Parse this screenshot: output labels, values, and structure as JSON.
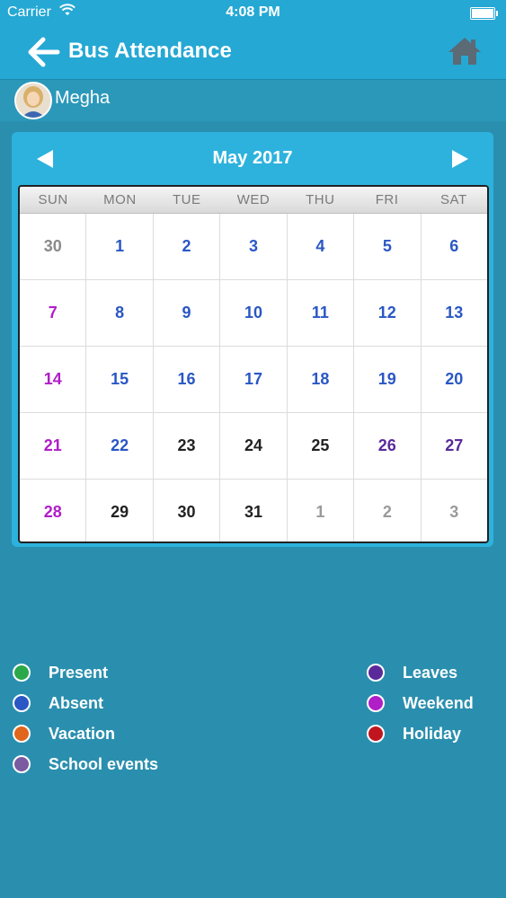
{
  "status": {
    "carrier": "Carrier",
    "time": "4:08 PM"
  },
  "header": {
    "title": "Bus Attendance"
  },
  "student": {
    "name": "Megha"
  },
  "calendar": {
    "month_label": "May 2017",
    "weekdays": [
      "SUN",
      "MON",
      "TUE",
      "WED",
      "THU",
      "FRI",
      "SAT"
    ],
    "weeks": [
      [
        {
          "d": "30",
          "c": "#8a8a8a"
        },
        {
          "d": "1",
          "c": "#2a57c4"
        },
        {
          "d": "2",
          "c": "#2a57c4"
        },
        {
          "d": "3",
          "c": "#2a57c4"
        },
        {
          "d": "4",
          "c": "#2a57c4"
        },
        {
          "d": "5",
          "c": "#2a57c4"
        },
        {
          "d": "6",
          "c": "#2a57c4"
        }
      ],
      [
        {
          "d": "7",
          "c": "#b01ec8"
        },
        {
          "d": "8",
          "c": "#2a57c4"
        },
        {
          "d": "9",
          "c": "#2a57c4"
        },
        {
          "d": "10",
          "c": "#2a57c4"
        },
        {
          "d": "11",
          "c": "#2a57c4"
        },
        {
          "d": "12",
          "c": "#2a57c4"
        },
        {
          "d": "13",
          "c": "#2a57c4"
        }
      ],
      [
        {
          "d": "14",
          "c": "#b01ec8"
        },
        {
          "d": "15",
          "c": "#2a57c4"
        },
        {
          "d": "16",
          "c": "#2a57c4"
        },
        {
          "d": "17",
          "c": "#2a57c4"
        },
        {
          "d": "18",
          "c": "#2a57c4"
        },
        {
          "d": "19",
          "c": "#2a57c4"
        },
        {
          "d": "20",
          "c": "#2a57c4"
        }
      ],
      [
        {
          "d": "21",
          "c": "#b01ec8"
        },
        {
          "d": "22",
          "c": "#2a57c4"
        },
        {
          "d": "23",
          "c": "#222222"
        },
        {
          "d": "24",
          "c": "#222222"
        },
        {
          "d": "25",
          "c": "#222222"
        },
        {
          "d": "26",
          "c": "#5a2a9a"
        },
        {
          "d": "27",
          "c": "#5a2a9a"
        }
      ],
      [
        {
          "d": "28",
          "c": "#b01ec8"
        },
        {
          "d": "29",
          "c": "#222222"
        },
        {
          "d": "30",
          "c": "#222222"
        },
        {
          "d": "31",
          "c": "#222222"
        },
        {
          "d": "1",
          "c": "#9a9a9a"
        },
        {
          "d": "2",
          "c": "#9a9a9a"
        },
        {
          "d": "3",
          "c": "#9a9a9a"
        }
      ]
    ]
  },
  "legend": {
    "left": [
      {
        "label": "Present",
        "color": "#2aa84a"
      },
      {
        "label": "Absent",
        "color": "#2a57c4"
      },
      {
        "label": "Vacation",
        "color": "#e0661c"
      },
      {
        "label": "School events",
        "color": "#7a5aa0"
      }
    ],
    "right": [
      {
        "label": "Leaves",
        "color": "#5a2a9a"
      },
      {
        "label": "Weekend",
        "color": "#b01ec8"
      },
      {
        "label": "Holiday",
        "color": "#c0151f"
      }
    ]
  }
}
